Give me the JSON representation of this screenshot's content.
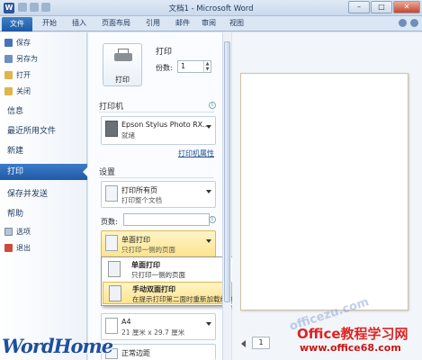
{
  "window": {
    "title": "文档1 - Microsoft Word",
    "min": "–",
    "max": "□",
    "close": "✕"
  },
  "ribbon_tabs": [
    "文件",
    "开始",
    "插入",
    "页面布局",
    "引用",
    "邮件",
    "审阅",
    "视图"
  ],
  "nav": {
    "items": [
      "保存",
      "另存为",
      "打开",
      "关闭",
      "信息",
      "最近所用文件",
      "新建",
      "打印",
      "保存并发送",
      "帮助",
      "选项",
      "退出"
    ]
  },
  "print": {
    "button_label": "打印",
    "heading": "打印",
    "copies_label": "份数:",
    "copies_value": "1",
    "printer_heading": "打印机",
    "printer_name": "Epson Stylus Photo RX...",
    "printer_status": "就绪",
    "printer_properties": "打印机属性",
    "settings_heading": "设置",
    "print_all_title": "打印所有页",
    "print_all_sub": "打印整个文档",
    "pages_label": "页数:",
    "simplex_title": "单面打印",
    "simplex_sub": "只打印一侧的页面",
    "paper_title": "A4",
    "paper_sub": "21 厘米 x 29.7 厘米",
    "margins_title": "正常边距"
  },
  "popup": {
    "items": [
      {
        "title": "单面打印",
        "sub": "只打印一侧的页面"
      },
      {
        "title": "手动双面打印",
        "sub": "在提示打印第二面时重新加载纸张"
      }
    ]
  },
  "preview": {
    "page_value": "1"
  },
  "watermarks": {
    "wordhome": "WordHome",
    "office_brand": "Office教程学习网",
    "office_url": "www.office68.com",
    "faint": "officezu.com"
  },
  "colors": {
    "accent": "#1f5aa6",
    "highlight": "#fde48c"
  }
}
